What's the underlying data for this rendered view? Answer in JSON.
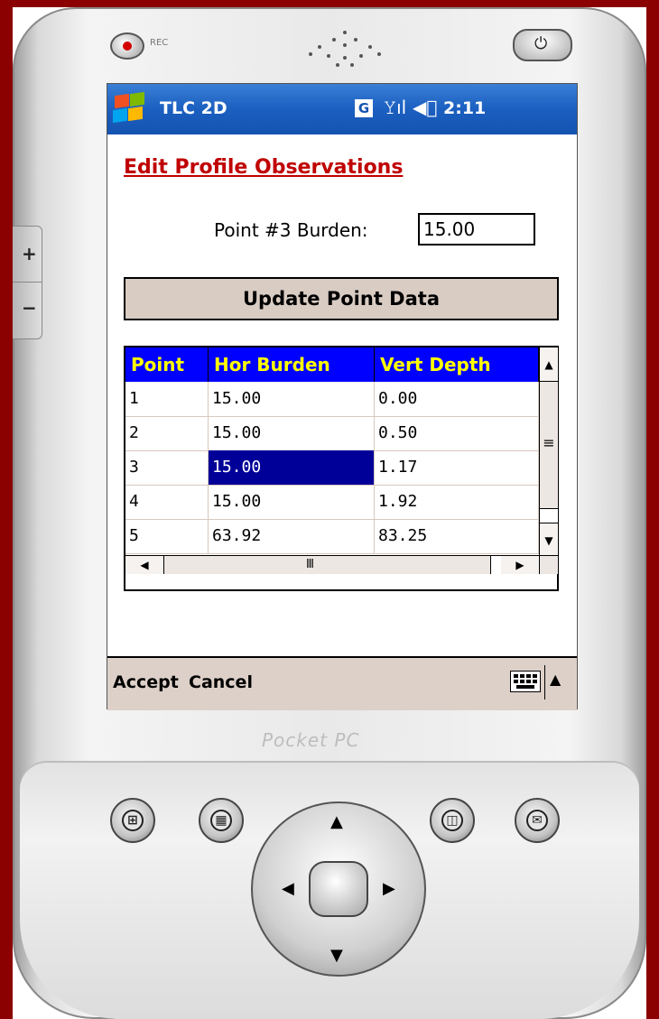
{
  "device": {
    "rec_label": "REC",
    "brand_logo": "Pocket PC"
  },
  "titlebar": {
    "app_title": "TLC 2D",
    "network_badge": "G",
    "time": "2:11"
  },
  "form": {
    "heading": "Edit Profile Observations",
    "burden_label": "Point #3 Burden:",
    "burden_value": "15.00",
    "update_button": "Update Point Data"
  },
  "grid": {
    "columns": [
      "Point",
      "Hor Burden",
      "Vert Depth"
    ],
    "rows": [
      [
        "1",
        "15.00",
        "0.00"
      ],
      [
        "2",
        "15.00",
        "0.50"
      ],
      [
        "3",
        "15.00",
        "1.17"
      ],
      [
        "4",
        "15.00",
        "1.92"
      ],
      [
        "5",
        "63.92",
        "83.25"
      ]
    ],
    "selected_row": 3,
    "selected_column": "Hor Burden",
    "header_bg": "#0000ff",
    "header_text": "#ffff00",
    "selection_bg": "#000099"
  },
  "softkeys": {
    "left": "Accept",
    "right": "Cancel",
    "input_icon": "keyboard-icon"
  },
  "hardware_buttons": [
    "start-icon",
    "calendar-icon",
    "contacts-icon",
    "mail-icon"
  ],
  "colors": {
    "heading": "#c00000",
    "titlebar": "#1b5fc0",
    "softbar": "#ddd0c8"
  }
}
